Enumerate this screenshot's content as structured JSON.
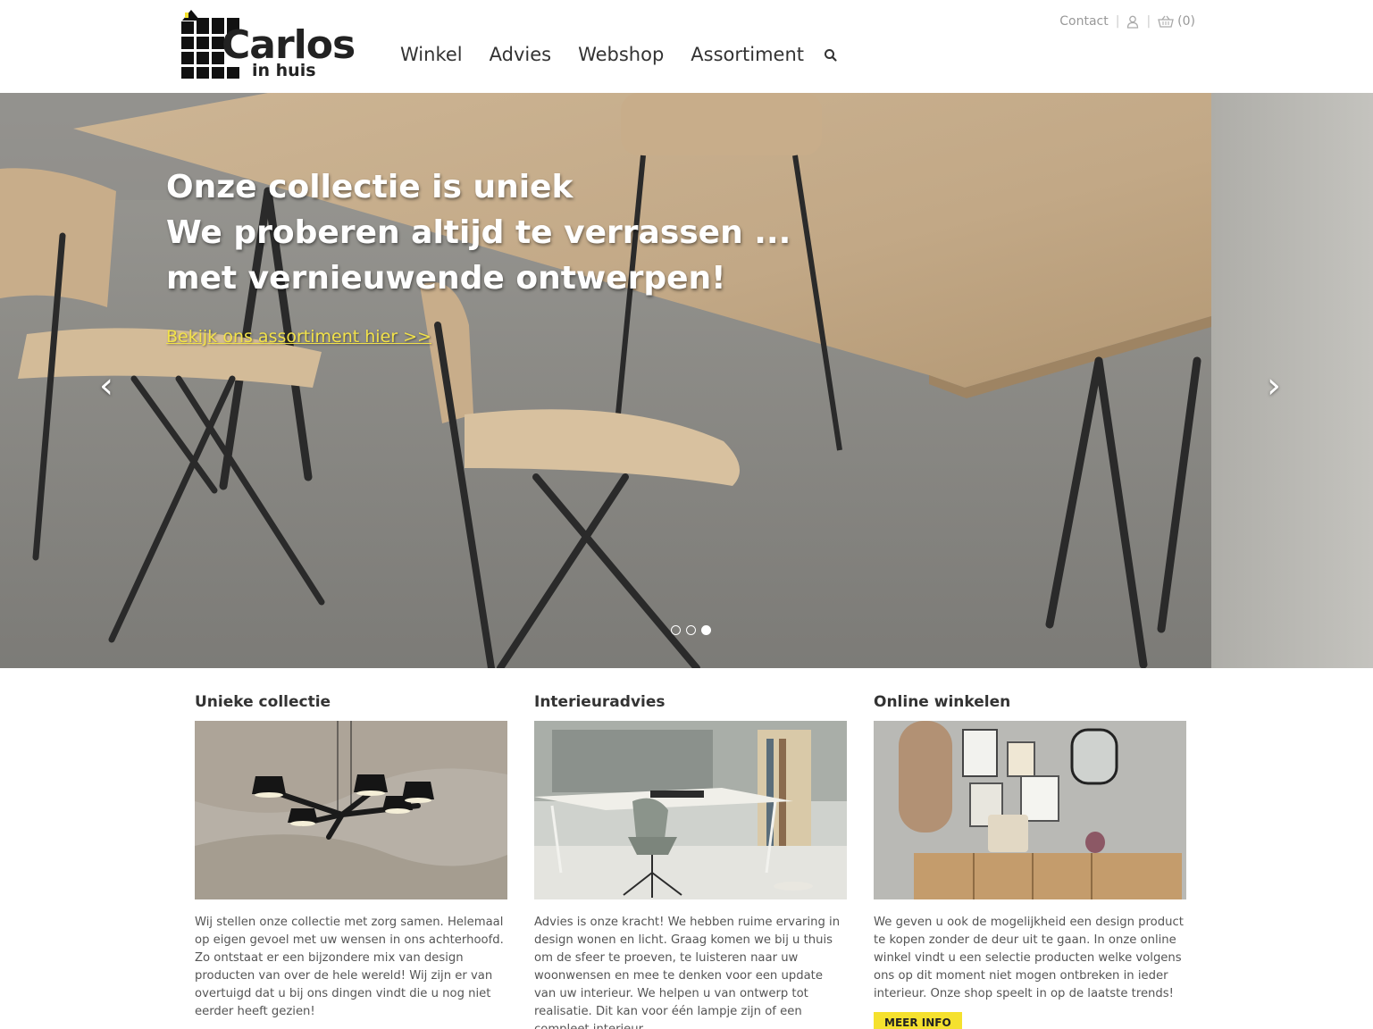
{
  "brand": {
    "name": "Carlos",
    "tagline": "in huis"
  },
  "nav": {
    "items": [
      {
        "label": "Winkel"
      },
      {
        "label": "Advies"
      },
      {
        "label": "Webshop"
      },
      {
        "label": "Assortiment"
      }
    ],
    "search_icon": "search-icon"
  },
  "topbar": {
    "contact": "Contact",
    "account_icon": "user-icon",
    "cart_icon": "basket-icon",
    "cart_count": "(0)"
  },
  "hero": {
    "lines": [
      "Onze collectie is uniek",
      "We proberen altijd te verrassen ...",
      "met vernieuwende ontwerpen!"
    ],
    "link": "Bekijk ons assortiment hier >>",
    "prev": "‹",
    "next": "›",
    "slides_total": 3,
    "active_slide": 3,
    "link_color": "#f2e24a"
  },
  "features": [
    {
      "title": "Unieke collectie",
      "text": "Wij stellen onze collectie met zorg samen. Helemaal op eigen gevoel met uw wensen in ons achterhoofd. Zo ontstaat er een bijzondere mix van design producten van over de hele wereld! Wij zijn er van overtuigd dat u bij ons dingen vindt die u nog niet eerder heeft gezien!"
    },
    {
      "title": "Interieuradvies",
      "text": "Advies is onze kracht! We hebben ruime ervaring in design wonen en licht. Graag komen we bij u thuis om de sfeer te proeven, te luisteren naar uw woonwensen en mee te denken voor een update van uw interieur. We helpen u van ontwerp tot realisatie. Dit kan voor één lampje zijn of een compleet interieur."
    },
    {
      "title": "Online winkelen",
      "text": "We geven u ook de mogelijkheid een design product te kopen zonder de deur uit te gaan. In onze online winkel vindt u een selectie producten welke volgens ons op dit moment niet mogen ontbreken in ieder interieur. Onze shop speelt in op de laatste trends!",
      "button": "MEER INFO"
    }
  ],
  "colors": {
    "accent": "#f5e12e",
    "text": "#333333"
  }
}
